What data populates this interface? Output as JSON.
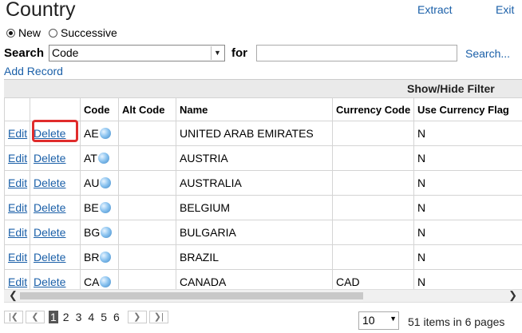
{
  "header": {
    "title": "Country",
    "extract_label": "Extract",
    "exit_label": "Exit"
  },
  "mode": {
    "options": [
      "New",
      "Successive"
    ],
    "selected": "New"
  },
  "search": {
    "label": "Search",
    "field_value": "Code",
    "for_label": "for",
    "for_value": "",
    "search_link": "Search..."
  },
  "add_record_label": "Add Record",
  "filter_label": "Show/Hide Filter",
  "table": {
    "columns": [
      "",
      "",
      "Code",
      "Alt Code",
      "Name",
      "Currency Code",
      "Use Currency Flag"
    ],
    "rows": [
      {
        "edit": "Edit",
        "delete": "Delete",
        "code": "AE",
        "alt_code": "",
        "name": "UNITED ARAB EMIRATES",
        "currency": "",
        "flag": "N"
      },
      {
        "edit": "Edit",
        "delete": "Delete",
        "code": "AT",
        "alt_code": "",
        "name": "AUSTRIA",
        "currency": "",
        "flag": "N"
      },
      {
        "edit": "Edit",
        "delete": "Delete",
        "code": "AU",
        "alt_code": "",
        "name": "AUSTRALIA",
        "currency": "",
        "flag": "N"
      },
      {
        "edit": "Edit",
        "delete": "Delete",
        "code": "BE",
        "alt_code": "",
        "name": "BELGIUM",
        "currency": "",
        "flag": "N"
      },
      {
        "edit": "Edit",
        "delete": "Delete",
        "code": "BG",
        "alt_code": "",
        "name": "BULGARIA",
        "currency": "",
        "flag": "N"
      },
      {
        "edit": "Edit",
        "delete": "Delete",
        "code": "BR",
        "alt_code": "",
        "name": "BRAZIL",
        "currency": "",
        "flag": "N"
      },
      {
        "edit": "Edit",
        "delete": "Delete",
        "code": "CA",
        "alt_code": "",
        "name": "CANADA",
        "currency": "CAD",
        "flag": "N"
      }
    ]
  },
  "pager": {
    "pages": [
      "1",
      "2",
      "3",
      "4",
      "5",
      "6"
    ],
    "current": "1",
    "page_size": "10",
    "summary": "51 items in 6 pages"
  },
  "colors": {
    "link": "#1a5fa8",
    "highlight": "#e02c2c"
  }
}
